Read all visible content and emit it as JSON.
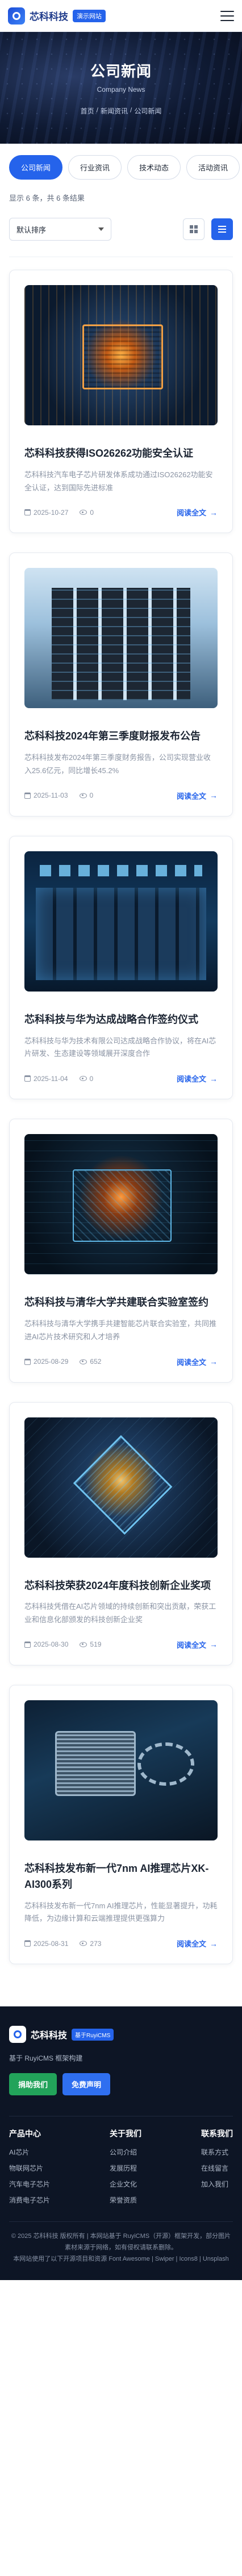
{
  "header": {
    "brand": "芯科科技",
    "badge": "演示网站"
  },
  "hero": {
    "title": "公司新闻",
    "subtitle": "Company News",
    "breadcrumb": [
      "首页",
      "新闻资讯",
      "公司新闻"
    ]
  },
  "tabs": [
    {
      "label": "公司新闻",
      "active": true
    },
    {
      "label": "行业资讯",
      "active": false
    },
    {
      "label": "技术动态",
      "active": false
    },
    {
      "label": "活动资讯",
      "active": false
    }
  ],
  "filter": {
    "count_text": "显示 6 条，共 6 条结果",
    "sort_value": "默认排序"
  },
  "articles": [
    {
      "title": "芯科科技获得ISO26262功能安全认证",
      "desc": "芯科科技汽车电子芯片研发体系成功通过ISO26262功能安全认证，达到国际先进标准",
      "date": "2025-10-27",
      "views": "0",
      "read_more": "阅读全文",
      "image": "chip"
    },
    {
      "title": "芯科科技2024年第三季度财报发布公告",
      "desc": "芯科科技发布2024年第三季度财务报告，公司实现营业收入25.6亿元，同比增长45.2%",
      "date": "2025-11-03",
      "views": "0",
      "read_more": "阅读全文",
      "image": "server"
    },
    {
      "title": "芯科科技与华为达成战略合作签约仪式",
      "desc": "芯科科技与华为技术有限公司达成战略合作协议，将在AI芯片研发、生态建设等领域展开深度合作",
      "date": "2025-11-04",
      "views": "0",
      "read_more": "阅读全文",
      "image": "room"
    },
    {
      "title": "芯科科技与清华大学共建联合实验室签约",
      "desc": "芯科科技与清华大学携手共建智能芯片联合实验室，共同推进AI芯片技术研究和人才培养",
      "date": "2025-08-29",
      "views": "652",
      "read_more": "阅读全文",
      "image": "lab"
    },
    {
      "title": "芯科科技荣获2024年度科技创新企业奖项",
      "desc": "芯科科技凭借在AI芯片领域的持续创新和突出贡献，荣获工业和信息化部颁发的科技创新企业奖",
      "date": "2025-08-30",
      "views": "519",
      "read_more": "阅读全文",
      "image": "award"
    },
    {
      "title": "芯科科技发布新一代7nm AI推理芯片XK-AI300系列",
      "desc": "芯科科技发布新一代7nm AI推理芯片，性能显著提升，功耗降低，为边缘计算和云端推理提供更强算力",
      "date": "2025-08-31",
      "views": "273",
      "read_more": "阅读全文",
      "image": "7nm"
    }
  ],
  "footer": {
    "brand": "芯科科技",
    "badge": "基于RuyiCMS",
    "desc": "基于 RuyiCMS 框架构建",
    "btn_primary": "捐助我们",
    "btn_secondary": "免费声明",
    "columns": [
      {
        "title": "产品中心",
        "items": [
          "AI芯片",
          "物联网芯片",
          "汽车电子芯片",
          "消费电子芯片"
        ]
      },
      {
        "title": "关于我们",
        "items": [
          "公司介绍",
          "发展历程",
          "企业文化",
          "荣誉资质"
        ]
      },
      {
        "title": "联系我们",
        "items": [
          "联系方式",
          "在线留言",
          "加入我们"
        ]
      }
    ],
    "copyright": "© 2025 芯科科技 版权所有 | 本网站基于 RuyiCMS（开源）框架开发，部分图片素材来源于网络，如有侵权请联系删除。",
    "credits": "本网站使用了以下开源项目和资源 Font Awesome | Swiper | Icons8 | Unsplash"
  }
}
